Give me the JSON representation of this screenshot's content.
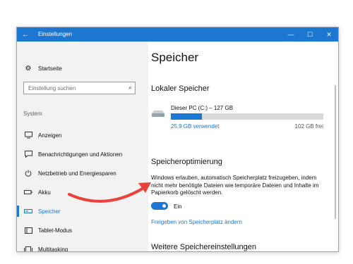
{
  "window": {
    "title": "Einstellungen",
    "back_icon": "←",
    "minimize_icon": "—",
    "maximize_icon": "☐",
    "close_icon": "✕"
  },
  "sidebar": {
    "home_label": "Startseite",
    "search_placeholder": "Einstellung suchen",
    "section_label": "System",
    "items": [
      {
        "label": "Anzeigen",
        "icon": "monitor-icon"
      },
      {
        "label": "Benachrichtigungen und Aktionen",
        "icon": "notification-icon"
      },
      {
        "label": "Netzbetrieb und Energiesparen",
        "icon": "power-icon"
      },
      {
        "label": "Akku",
        "icon": "battery-icon"
      },
      {
        "label": "Speicher",
        "icon": "storage-icon",
        "selected": true
      },
      {
        "label": "Tablet-Modus",
        "icon": "tablet-icon"
      },
      {
        "label": "Multitasking",
        "icon": "multitasking-icon"
      }
    ]
  },
  "main": {
    "title": "Speicher",
    "local_heading": "Lokaler Speicher",
    "drive": {
      "name": "Dieser PC (C:) – 127 GB",
      "used": "25,9 GB verwendet",
      "free": "102 GB frei",
      "used_fraction": 0.204
    },
    "optimization_heading": "Speicheroptimierung",
    "optimization_desc": "Windows erlauben, automatisch Speicherplatz freizugeben, indem nicht mehr benötigte Dateien wie temporäre Dateien und Inhalte im Papierkorb gelöscht werden.",
    "toggle_label": "Ein",
    "toggle_on": true,
    "change_link": "Freigeben von Speicherplatz ändern",
    "more_heading": "Weitere Speichereinstellungen"
  },
  "colors": {
    "accent": "#1b77d2",
    "annotation_arrow": "#e8423a"
  }
}
